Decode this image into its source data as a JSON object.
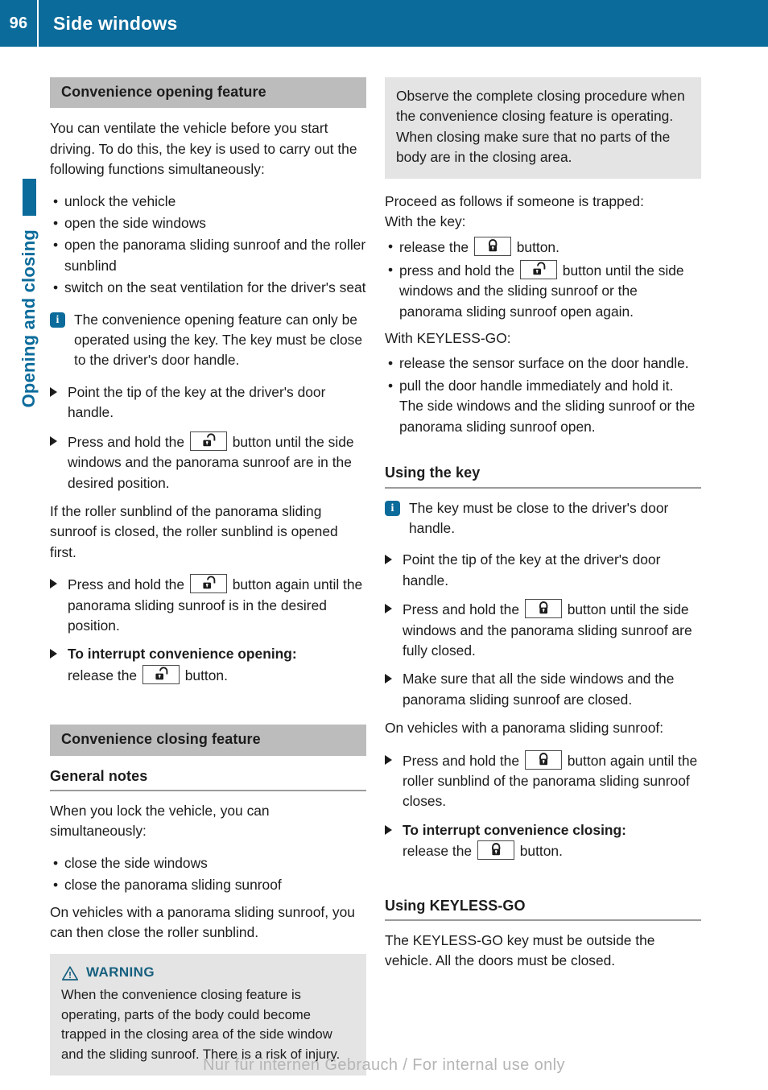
{
  "header": {
    "page_number": "96",
    "title": "Side windows",
    "bar_color": "#0b6b9b"
  },
  "side_tab": {
    "label": "Opening and closing",
    "color": "#0b6b9b"
  },
  "icons": {
    "info": "i",
    "unlock": "unlock-button-icon",
    "lock": "lock-button-icon",
    "warning": "warning-triangle-icon"
  },
  "left_column": {
    "section1": {
      "bar_title": "Convenience opening feature",
      "intro": "You can ventilate the vehicle before you start driving. To do this, the key is used to carry out the following functions simultaneously:",
      "bullets": [
        "unlock the vehicle",
        "open the side windows",
        "open the panorama sliding sunroof and the roller sunblind",
        "switch on the seat ventilation for the driver's seat"
      ],
      "note": "The convenience opening feature can only be operated using the key. The key must be close to the driver's door handle.",
      "step1": "Point the tip of the key at the driver's door handle.",
      "step2_pre": "Press and hold the",
      "step2_post": "button until the side windows and the panorama sunroof are in the desired position.",
      "para": "If the roller sunblind of the panorama sliding sunroof is closed, the roller sunblind is opened first.",
      "step3_pre": "Press and hold the",
      "step3_post": "button again until the panorama sliding sunroof is in the desired position.",
      "step4_bold": "To interrupt convenience opening:",
      "step4_pre": "release the",
      "step4_post": "button."
    },
    "section2": {
      "bar_title": "Convenience closing feature",
      "subhead": "General notes",
      "intro": "When you lock the vehicle, you can simultaneously:",
      "bullets": [
        "close the side windows",
        "close the panorama sliding sunroof"
      ],
      "para": "On vehicles with a panorama sliding sunroof, you can then close the roller sunblind.",
      "warning_label": "WARNING",
      "warning_text": "When the convenience closing feature is operating, parts of the body could become trapped in the closing area of the side window and the sliding sunroof. There is a risk of injury."
    }
  },
  "right_column": {
    "callout": "Observe the complete closing procedure when the convenience closing feature is operating. When closing make sure that no parts of the body are in the closing area.",
    "proceed_line1": "Proceed as follows if someone is trapped:",
    "proceed_line2": "With the key:",
    "key_bullets": {
      "b1_pre": "release the",
      "b1_post": "button.",
      "b2_pre": "press and hold the",
      "b2_post": "button until the side windows and the sliding sunroof or the panorama sliding sunroof open again."
    },
    "keyless_intro": "With KEYLESS-GO:",
    "keyless_bullets": [
      "release the sensor surface on the door handle.",
      "pull the door handle immediately and hold it."
    ],
    "keyless_sub": "The side windows and the sliding sunroof or the panorama sliding sunroof open.",
    "section_using_key": {
      "subhead": "Using the key",
      "note": "The key must be close to the driver's door handle.",
      "step1": "Point the tip of the key at the driver's door handle.",
      "step2_pre": "Press and hold the",
      "step2_post": "button until the side windows and the panorama sliding sunroof are fully closed.",
      "step3": "Make sure that all the side windows and the panorama sliding sunroof are closed.",
      "para": "On vehicles with a panorama sliding sunroof:",
      "step4_pre": "Press and hold the",
      "step4_post": "button again until the roller sunblind of the panorama sliding sunroof closes.",
      "step5_bold": "To interrupt convenience closing:",
      "step5_pre": "release the",
      "step5_post": "button."
    },
    "section_keyless": {
      "subhead": "Using KEYLESS-GO",
      "para": "The KEYLESS-GO key must be outside the vehicle. All the doors must be closed."
    }
  },
  "footer": {
    "text": "Nur für internen Gebrauch / For internal use only"
  }
}
